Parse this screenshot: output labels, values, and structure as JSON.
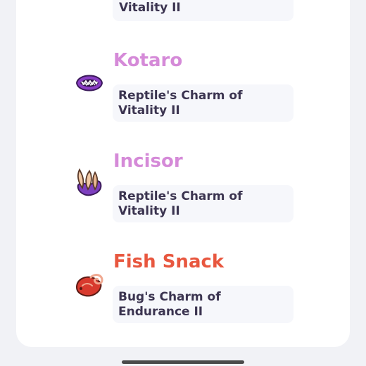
{
  "rows": [
    {
      "name": "",
      "charm_line1": "",
      "charm_line2": "Vitality II",
      "name_color": "#d58ad8",
      "icon": "none"
    },
    {
      "name": "Kotaro",
      "charm_line1": "Reptile's Charm of",
      "charm_line2": "Vitality II",
      "name_color": "#d58ad8",
      "icon": "purple-mouth-icon"
    },
    {
      "name": "Incisor",
      "charm_line1": "Reptile's Charm of",
      "charm_line2": "Vitality II",
      "name_color": "#d58ad8",
      "icon": "fang-icon"
    },
    {
      "name": "Fish Snack",
      "charm_line1": "Bug's Charm of",
      "charm_line2": "Endurance II",
      "name_color": "#e8573f",
      "icon": "red-fish-icon"
    }
  ]
}
